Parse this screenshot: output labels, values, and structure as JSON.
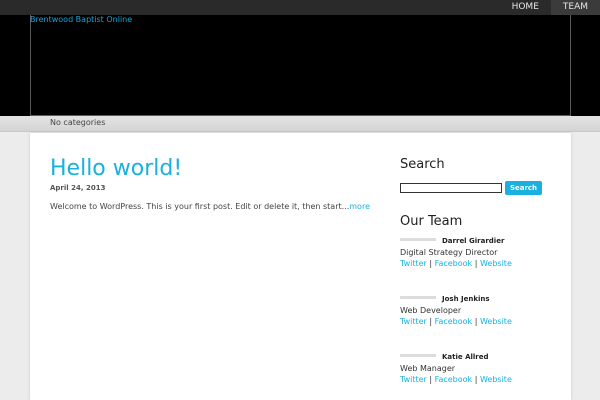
{
  "nav": {
    "home": "HOME",
    "team": "TEAM"
  },
  "site": {
    "title": "Brentwood Baptist Online"
  },
  "categories": {
    "text": "No categories"
  },
  "post": {
    "title": "Hello world!",
    "date": "April 24, 2013",
    "excerpt": "Welcome to WordPress. This is your first post. Edit or delete it, then start...",
    "more": "more"
  },
  "sidebar": {
    "search_title": "Search",
    "search_button": "Search",
    "search_value": "",
    "team_title": "Our Team",
    "separator": " | ",
    "members": [
      {
        "name": "Darrel Girardier",
        "role": "Digital Strategy Director",
        "twitter": "Twitter",
        "facebook": "Facebook",
        "website": "Website"
      },
      {
        "name": "Josh Jenkins",
        "role": "Web Developer",
        "twitter": "Twitter",
        "facebook": "Facebook",
        "website": "Website"
      },
      {
        "name": "Katie Allred",
        "role": "Web Manager",
        "twitter": "Twitter",
        "facebook": "Facebook",
        "website": "Website"
      }
    ]
  },
  "colors": {
    "accent": "#1ab0df",
    "topbar": "#2a2a2a",
    "header": "#000000"
  }
}
